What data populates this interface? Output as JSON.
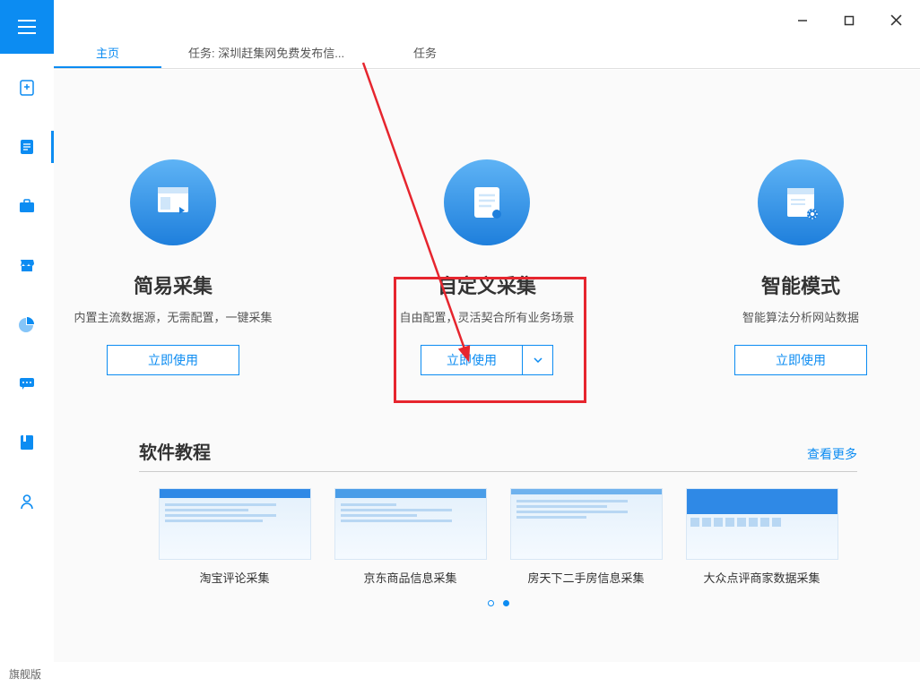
{
  "title_bar": {},
  "tabs": [
    {
      "label": "主页",
      "active": true
    },
    {
      "label": "任务: 深圳赶集网免费发布信...",
      "active": false
    },
    {
      "label": "任务",
      "active": false
    }
  ],
  "cards": [
    {
      "title": "简易采集",
      "desc": "内置主流数据源，无需配置，一键采集",
      "btn": "立即使用",
      "dropdown": false
    },
    {
      "title": "自定义采集",
      "desc": "自由配置，灵活契合所有业务场景",
      "btn": "立即使用",
      "dropdown": true,
      "highlighted": true
    },
    {
      "title": "智能模式",
      "desc": "智能算法分析网站数据",
      "btn": "立即使用",
      "dropdown": false
    }
  ],
  "tutorial": {
    "title": "软件教程",
    "more": "查看更多",
    "items": [
      {
        "label": "淘宝评论采集"
      },
      {
        "label": "京东商品信息采集"
      },
      {
        "label": "房天下二手房信息采集"
      },
      {
        "label": "大众点评商家数据采集"
      }
    ]
  },
  "footer": {
    "version": "旗舰版"
  },
  "colors": {
    "primary": "#0c8cf2",
    "highlight": "#e6252e"
  }
}
